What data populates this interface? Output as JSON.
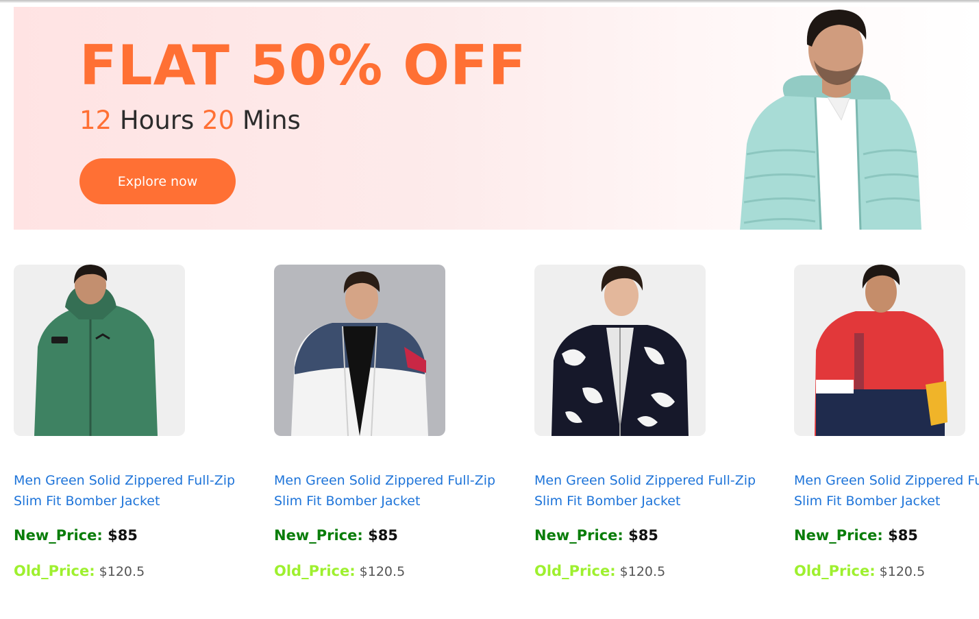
{
  "banner": {
    "headline": "FLAT 50% OFF",
    "timer": {
      "hours": "12",
      "hours_label": "Hours",
      "minutes": "20",
      "minutes_label": "Mins"
    },
    "cta_label": "Explore now",
    "accent_color": "#ff7034"
  },
  "products": [
    {
      "title": "Men Green Solid Zippered Full-Zip Slim Fit Bomber Jacket",
      "new_price_label": "New_Price:",
      "new_price": "$85",
      "old_price_label": "Old_Price:",
      "old_price": "$120.5"
    },
    {
      "title": "Men Green Solid Zippered Full-Zip Slim Fit Bomber Jacket",
      "new_price_label": "New_Price:",
      "new_price": "$85",
      "old_price_label": "Old_Price:",
      "old_price": "$120.5"
    },
    {
      "title": "Men Green Solid Zippered Full-Zip Slim Fit Bomber Jacket",
      "new_price_label": "New_Price:",
      "new_price": "$85",
      "old_price_label": "Old_Price:",
      "old_price": "$120.5"
    },
    {
      "title": "Men Green Solid Zippered Full-Zip Slim Fit Bomber Jacket",
      "new_price_label": "New_Price:",
      "new_price": "$85",
      "old_price_label": "Old_Price:",
      "old_price": "$120.5"
    }
  ],
  "colors": {
    "title_link": "#1e74d9",
    "new_price_label": "#0a7d0a",
    "old_price_label": "#9ef02f"
  }
}
